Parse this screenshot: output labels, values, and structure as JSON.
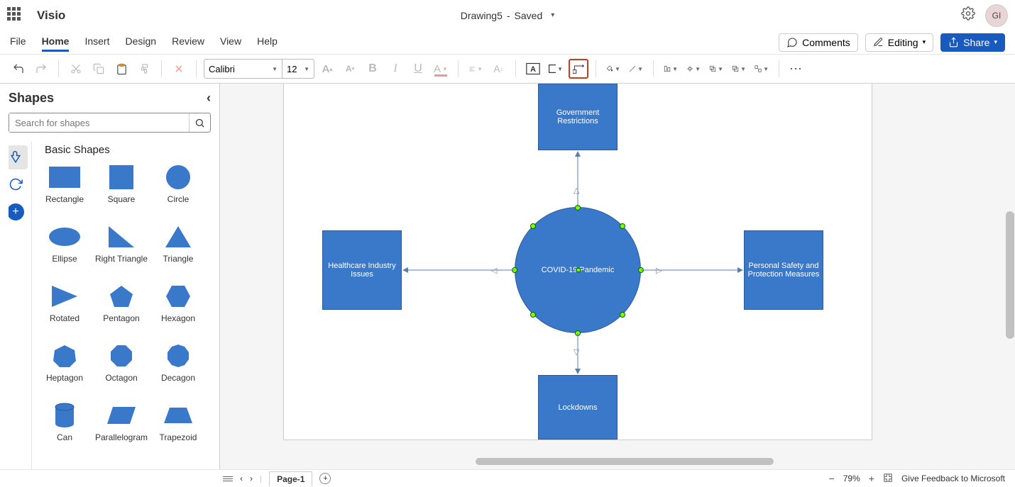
{
  "app": {
    "name": "Visio",
    "avatar_initials": "GI"
  },
  "document": {
    "name": "Drawing5",
    "status": "Saved"
  },
  "tabs": [
    "File",
    "Home",
    "Insert",
    "Design",
    "Review",
    "View",
    "Help"
  ],
  "active_tab": "Home",
  "actions": {
    "comments": "Comments",
    "editing": "Editing",
    "share": "Share"
  },
  "ribbon": {
    "font_name": "Calibri",
    "font_size": "12"
  },
  "shapes_panel": {
    "title": "Shapes",
    "search_placeholder": "Search for shapes",
    "stencil_title": "Basic Shapes",
    "shapes": [
      "Rectangle",
      "Square",
      "Circle",
      "Ellipse",
      "Right Triangle",
      "Triangle",
      "Rotated",
      "Pentagon",
      "Hexagon",
      "Heptagon",
      "Octagon",
      "Decagon",
      "Can",
      "Parallelogram",
      "Trapezoid"
    ]
  },
  "canvas": {
    "center_label": "COVID-19 Pandemic",
    "top_label": "Government Restrictions",
    "left_label": "Healthcare Industry Issues",
    "right_label": "Personal Safety and Protection Measures",
    "bottom_label": "Lockdowns"
  },
  "footer": {
    "page_name": "Page-1",
    "zoom": "79%",
    "feedback": "Give Feedback to Microsoft"
  }
}
